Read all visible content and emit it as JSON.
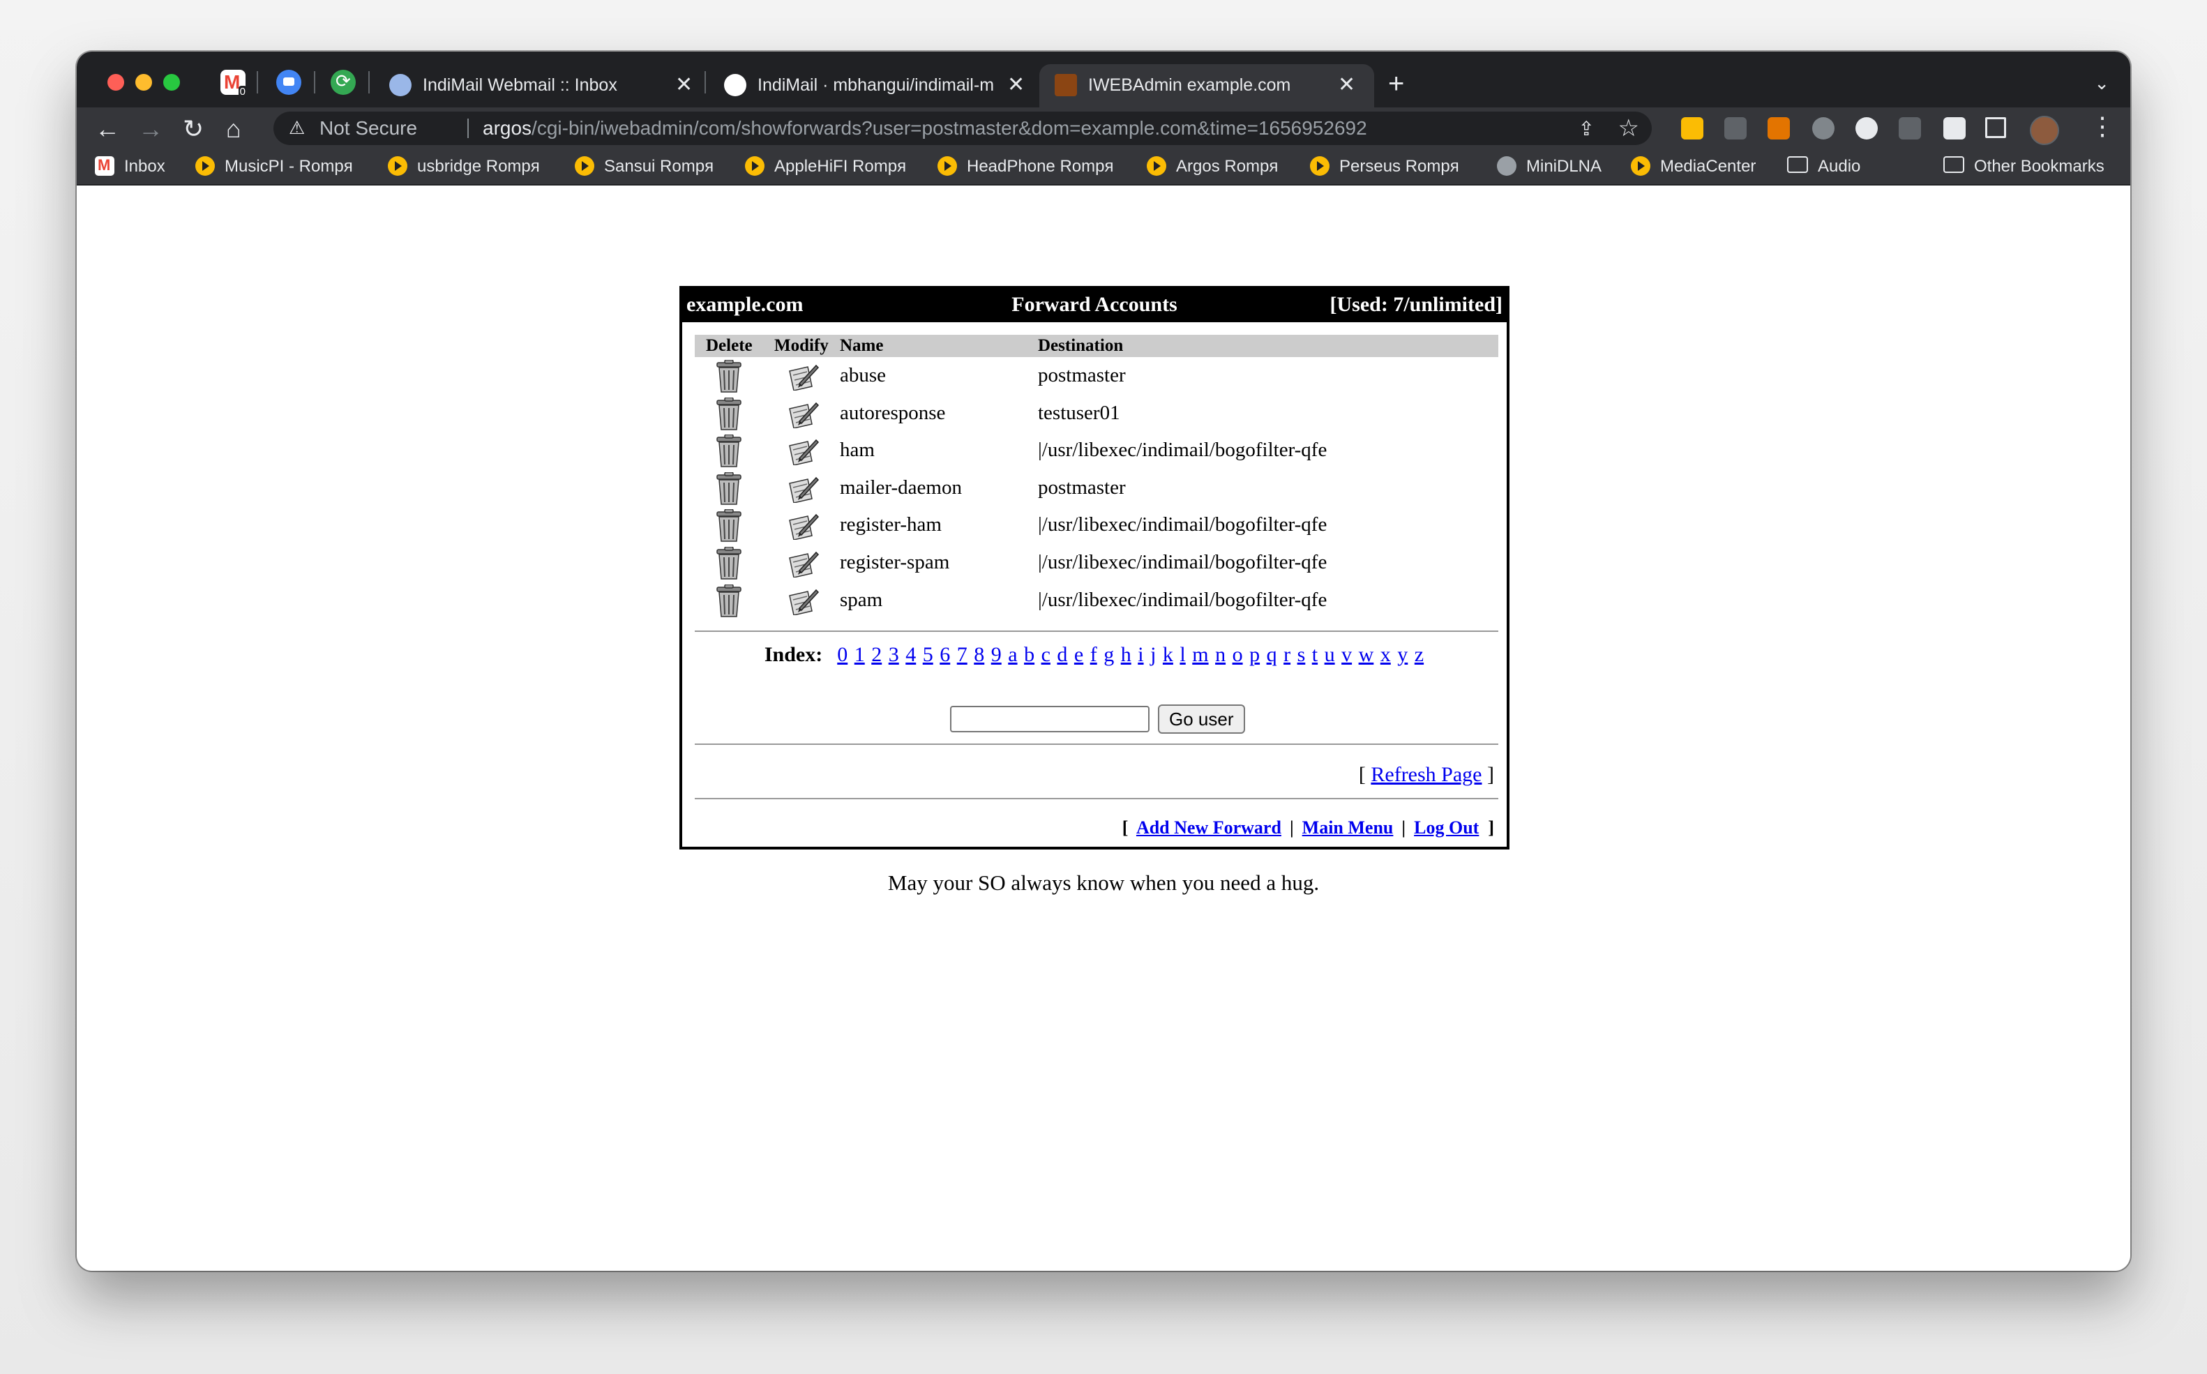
{
  "browser": {
    "tabs": [
      {
        "title": "IndiMail Webmail :: Inbox",
        "icon": "webmail-icon"
      },
      {
        "title": "IndiMail · mbhangui/indimail-m",
        "icon": "github-icon"
      },
      {
        "title": "IWEBAdmin example.com",
        "icon": "iwebadmin-icon",
        "active": true
      }
    ],
    "security_label": "Not Secure",
    "url_host": "argos",
    "url_path": "/cgi-bin/iwebadmin/com/showforwards?user=postmaster&dom=example.com&time=1656952692",
    "bookmarks": [
      {
        "label": "Inbox",
        "icon": "gmail-icon"
      },
      {
        "label": "MusicPI - Rompя",
        "icon": "play-icon"
      },
      {
        "label": "usbridge Rompя",
        "icon": "play-icon"
      },
      {
        "label": "Sansui Rompя",
        "icon": "play-icon"
      },
      {
        "label": "AppleHiFI Rompя",
        "icon": "play-icon"
      },
      {
        "label": "HeadPhone Rompя",
        "icon": "play-icon"
      },
      {
        "label": "Argos Rompя",
        "icon": "play-icon"
      },
      {
        "label": "Perseus Rompя",
        "icon": "play-icon"
      },
      {
        "label": "MiniDLNA",
        "icon": "globe-icon"
      },
      {
        "label": "MediaCenter",
        "icon": "play-icon"
      },
      {
        "label": "Audio",
        "icon": "folder-icon"
      },
      {
        "label": "Other Bookmarks",
        "icon": "folder-icon"
      }
    ]
  },
  "panel": {
    "domain": "example.com",
    "title": "Forward Accounts",
    "used": "[Used: 7/unlimited]",
    "columns": {
      "delete": "Delete",
      "modify": "Modify",
      "name": "Name",
      "destination": "Destination"
    },
    "rows": [
      {
        "name": "abuse",
        "destination": "postmaster"
      },
      {
        "name": "autoresponse",
        "destination": "testuser01"
      },
      {
        "name": "ham",
        "destination": "|/usr/libexec/indimail/bogofilter-qfe"
      },
      {
        "name": "mailer-daemon",
        "destination": "postmaster"
      },
      {
        "name": "register-ham",
        "destination": "|/usr/libexec/indimail/bogofilter-qfe"
      },
      {
        "name": "register-spam",
        "destination": "|/usr/libexec/indimail/bogofilter-qfe"
      },
      {
        "name": "spam",
        "destination": "|/usr/libexec/indimail/bogofilter-qfe"
      }
    ],
    "index_label": "Index:",
    "index": [
      "0",
      "1",
      "2",
      "3",
      "4",
      "5",
      "6",
      "7",
      "8",
      "9",
      "a",
      "b",
      "c",
      "d",
      "e",
      "f",
      "g",
      "h",
      "i",
      "j",
      "k",
      "l",
      "m",
      "n",
      "o",
      "p",
      "q",
      "r",
      "s",
      "t",
      "u",
      "v",
      "w",
      "x",
      "y",
      "z"
    ],
    "go_user": {
      "value": "",
      "button": "Go user"
    },
    "refresh": "Refresh Page",
    "footer": {
      "add": "Add New Forward",
      "menu": "Main Menu",
      "logout": "Log Out"
    }
  },
  "tagline": "May your SO always know when you need a hug."
}
